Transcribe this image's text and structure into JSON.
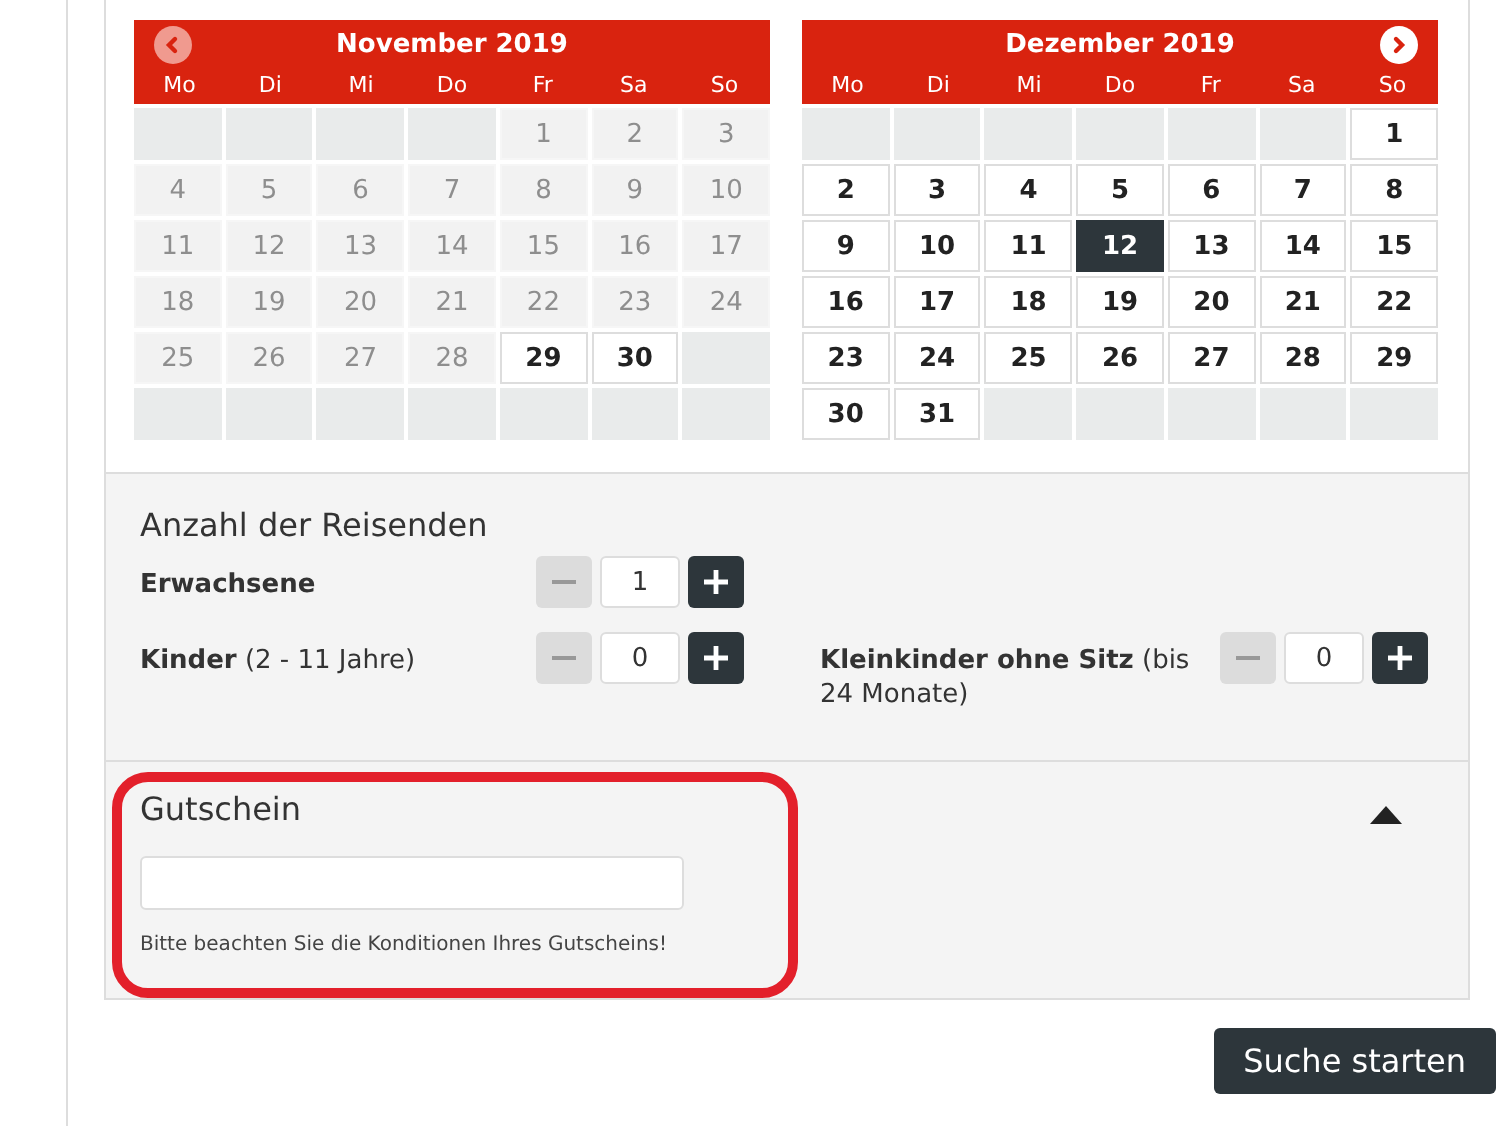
{
  "calendars": [
    {
      "title": "November 2019",
      "nav": {
        "kind": "prev",
        "disabled": true
      },
      "weekdays": [
        "Mo",
        "Di",
        "Mi",
        "Do",
        "Fr",
        "Sa",
        "So"
      ],
      "weeks": [
        [
          {
            "kind": "empty"
          },
          {
            "kind": "empty"
          },
          {
            "kind": "empty"
          },
          {
            "kind": "empty"
          },
          {
            "kind": "disabled",
            "day": "1"
          },
          {
            "kind": "disabled",
            "day": "2"
          },
          {
            "kind": "disabled",
            "day": "3"
          }
        ],
        [
          {
            "kind": "disabled",
            "day": "4"
          },
          {
            "kind": "disabled",
            "day": "5"
          },
          {
            "kind": "disabled",
            "day": "6"
          },
          {
            "kind": "disabled",
            "day": "7"
          },
          {
            "kind": "disabled",
            "day": "8"
          },
          {
            "kind": "disabled",
            "day": "9"
          },
          {
            "kind": "disabled",
            "day": "10"
          }
        ],
        [
          {
            "kind": "disabled",
            "day": "11"
          },
          {
            "kind": "disabled",
            "day": "12"
          },
          {
            "kind": "disabled",
            "day": "13"
          },
          {
            "kind": "disabled",
            "day": "14"
          },
          {
            "kind": "disabled",
            "day": "15"
          },
          {
            "kind": "disabled",
            "day": "16"
          },
          {
            "kind": "disabled",
            "day": "17"
          }
        ],
        [
          {
            "kind": "disabled",
            "day": "18"
          },
          {
            "kind": "disabled",
            "day": "19"
          },
          {
            "kind": "disabled",
            "day": "20"
          },
          {
            "kind": "disabled",
            "day": "21"
          },
          {
            "kind": "disabled",
            "day": "22"
          },
          {
            "kind": "disabled",
            "day": "23"
          },
          {
            "kind": "disabled",
            "day": "24"
          }
        ],
        [
          {
            "kind": "disabled",
            "day": "25"
          },
          {
            "kind": "disabled",
            "day": "26"
          },
          {
            "kind": "disabled",
            "day": "27"
          },
          {
            "kind": "disabled",
            "day": "28"
          },
          {
            "kind": "available",
            "day": "29"
          },
          {
            "kind": "available",
            "day": "30"
          },
          {
            "kind": "empty"
          }
        ],
        [
          {
            "kind": "empty"
          },
          {
            "kind": "empty"
          },
          {
            "kind": "empty"
          },
          {
            "kind": "empty"
          },
          {
            "kind": "empty"
          },
          {
            "kind": "empty"
          },
          {
            "kind": "empty"
          }
        ]
      ]
    },
    {
      "title": "Dezember 2019",
      "nav": {
        "kind": "next",
        "disabled": false
      },
      "weekdays": [
        "Mo",
        "Di",
        "Mi",
        "Do",
        "Fr",
        "Sa",
        "So"
      ],
      "weeks": [
        [
          {
            "kind": "empty"
          },
          {
            "kind": "empty"
          },
          {
            "kind": "empty"
          },
          {
            "kind": "empty"
          },
          {
            "kind": "empty"
          },
          {
            "kind": "empty"
          },
          {
            "kind": "available",
            "day": "1"
          }
        ],
        [
          {
            "kind": "available",
            "day": "2"
          },
          {
            "kind": "available",
            "day": "3"
          },
          {
            "kind": "available",
            "day": "4"
          },
          {
            "kind": "available",
            "day": "5"
          },
          {
            "kind": "available",
            "day": "6"
          },
          {
            "kind": "available",
            "day": "7"
          },
          {
            "kind": "available",
            "day": "8"
          }
        ],
        [
          {
            "kind": "available",
            "day": "9"
          },
          {
            "kind": "available",
            "day": "10"
          },
          {
            "kind": "available",
            "day": "11"
          },
          {
            "kind": "selected",
            "day": "12"
          },
          {
            "kind": "available",
            "day": "13"
          },
          {
            "kind": "available",
            "day": "14"
          },
          {
            "kind": "available",
            "day": "15"
          }
        ],
        [
          {
            "kind": "available",
            "day": "16"
          },
          {
            "kind": "available",
            "day": "17"
          },
          {
            "kind": "available",
            "day": "18"
          },
          {
            "kind": "available",
            "day": "19"
          },
          {
            "kind": "available",
            "day": "20"
          },
          {
            "kind": "available",
            "day": "21"
          },
          {
            "kind": "available",
            "day": "22"
          }
        ],
        [
          {
            "kind": "available",
            "day": "23"
          },
          {
            "kind": "available",
            "day": "24"
          },
          {
            "kind": "available",
            "day": "25"
          },
          {
            "kind": "available",
            "day": "26"
          },
          {
            "kind": "available",
            "day": "27"
          },
          {
            "kind": "available",
            "day": "28"
          },
          {
            "kind": "available",
            "day": "29"
          }
        ],
        [
          {
            "kind": "available",
            "day": "30"
          },
          {
            "kind": "available",
            "day": "31"
          },
          {
            "kind": "empty"
          },
          {
            "kind": "empty"
          },
          {
            "kind": "empty"
          },
          {
            "kind": "empty"
          },
          {
            "kind": "empty"
          }
        ]
      ]
    }
  ],
  "travellers": {
    "title": "Anzahl der Reisenden",
    "counters": [
      {
        "label": "Erwachsene",
        "value": "1",
        "decrement_disabled": true
      },
      {
        "label": "Kinder",
        "note": "(2 - 11 Jahre)",
        "value": "0",
        "decrement_disabled": true
      },
      {
        "label": "Kleinkinder ohne Sitz",
        "note": "(bis 24 Monate)",
        "value": "0",
        "decrement_disabled": true
      }
    ]
  },
  "voucher": {
    "title": "Gutschein",
    "expanded": true,
    "highlighted": true,
    "hint": "Bitte beachten Sie die Konditionen Ihres Gutscheins!"
  },
  "search_button": "Suche starten"
}
